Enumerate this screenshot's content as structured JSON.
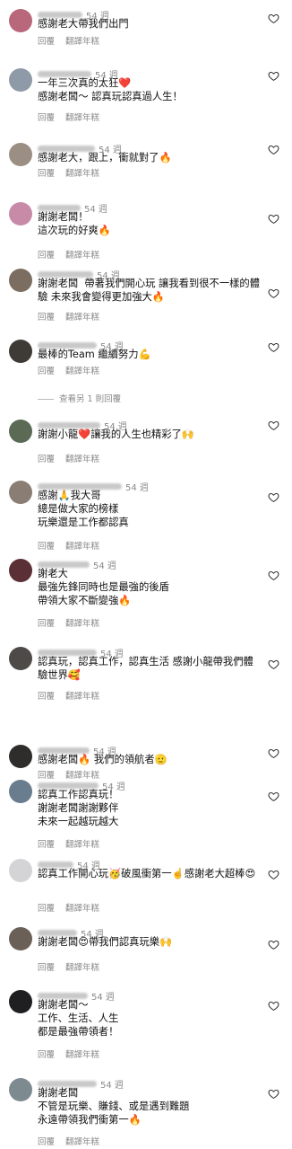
{
  "ui": {
    "reply_label": "回覆",
    "translate_label": "翻譯年糕",
    "more_replies": "查看另 1 則回覆"
  },
  "comments": [
    {
      "time": "54 週",
      "text": "感謝老大帶我們出門",
      "avatar": "#b9677a",
      "name_w": 50
    },
    {
      "time": "54 週",
      "text": "一年三次真的太狂❤️\n感謝老闆～ 認真玩認真過人生！",
      "avatar": "#8f9aa8",
      "name_w": 60
    },
    {
      "time": "54 週",
      "text": "感謝老大，跟上，衝就對了🔥",
      "avatar": "#9b8f83",
      "name_w": 64
    },
    {
      "time": "54 週",
      "text": "謝謝老闆！\n這次玩的好爽🔥",
      "avatar": "#c78ba8",
      "name_w": 48
    },
    {
      "time": "54 週",
      "text": "謝謝老闆  帶著我們開心玩 讓我看到很不一樣的體驗 未來我會變得更加強大🔥",
      "avatar": "#7b6d5f",
      "name_w": 62
    },
    {
      "time": "54 週",
      "text": "最棒的Team 繼續努力💪",
      "avatar": "#3e3a36",
      "name_w": 66
    },
    {
      "time": "54 週",
      "text": "謝謝小龍❤️讓我的人生也精彩了🙌",
      "avatar": "#5a6a55",
      "name_w": 70
    },
    {
      "time": "54 週",
      "text": "感謝🙏我大哥\n總是做大家的榜樣\n玩樂還是工作都認真",
      "avatar": "#8a7d74",
      "name_w": 94
    },
    {
      "time": "54 週",
      "text": "謝老大\n最強先鋒同時也是最強的後盾\n帶領大家不斷變強🔥",
      "avatar": "#5b2f36",
      "name_w": 58
    },
    {
      "time": "54 週",
      "text": "認真玩，認真工作，認真生活 感謝小龍帶我們體驗世界🥰",
      "avatar": "#4e4a47",
      "name_w": 66
    },
    {
      "time": "54 週",
      "text": "感謝老闆🔥 我們的領航者🫡",
      "avatar": "#2f2d2c",
      "name_w": 58
    },
    {
      "time": "54 週",
      "text": "認真工作認真玩！\n謝謝老闆謝謝夥伴\n未來一起越玩越大",
      "avatar": "#6a7d8e",
      "name_w": 68
    },
    {
      "time": "54 週",
      "text": "認真工作開心玩🥳破風衝第一☝️感謝老大超棒😍",
      "avatar": "#d4d4d6",
      "name_w": 40
    },
    {
      "time": "54 週",
      "text": "謝謝老闆😍帶我們認真玩樂🙌",
      "avatar": "#6b6058",
      "name_w": 44
    },
    {
      "time": "54 週",
      "text": "謝謝老闆～\n工作、生活、人生\n都是最強帶領者！",
      "avatar": "#1f1f22",
      "name_w": 56
    },
    {
      "time": "54 週",
      "text": "謝謝老闆\n不管是玩樂、賺錢、或是遇到難題\n永遠帶領我們衝第一🔥",
      "avatar": "#7d8a90",
      "name_w": 66
    }
  ]
}
